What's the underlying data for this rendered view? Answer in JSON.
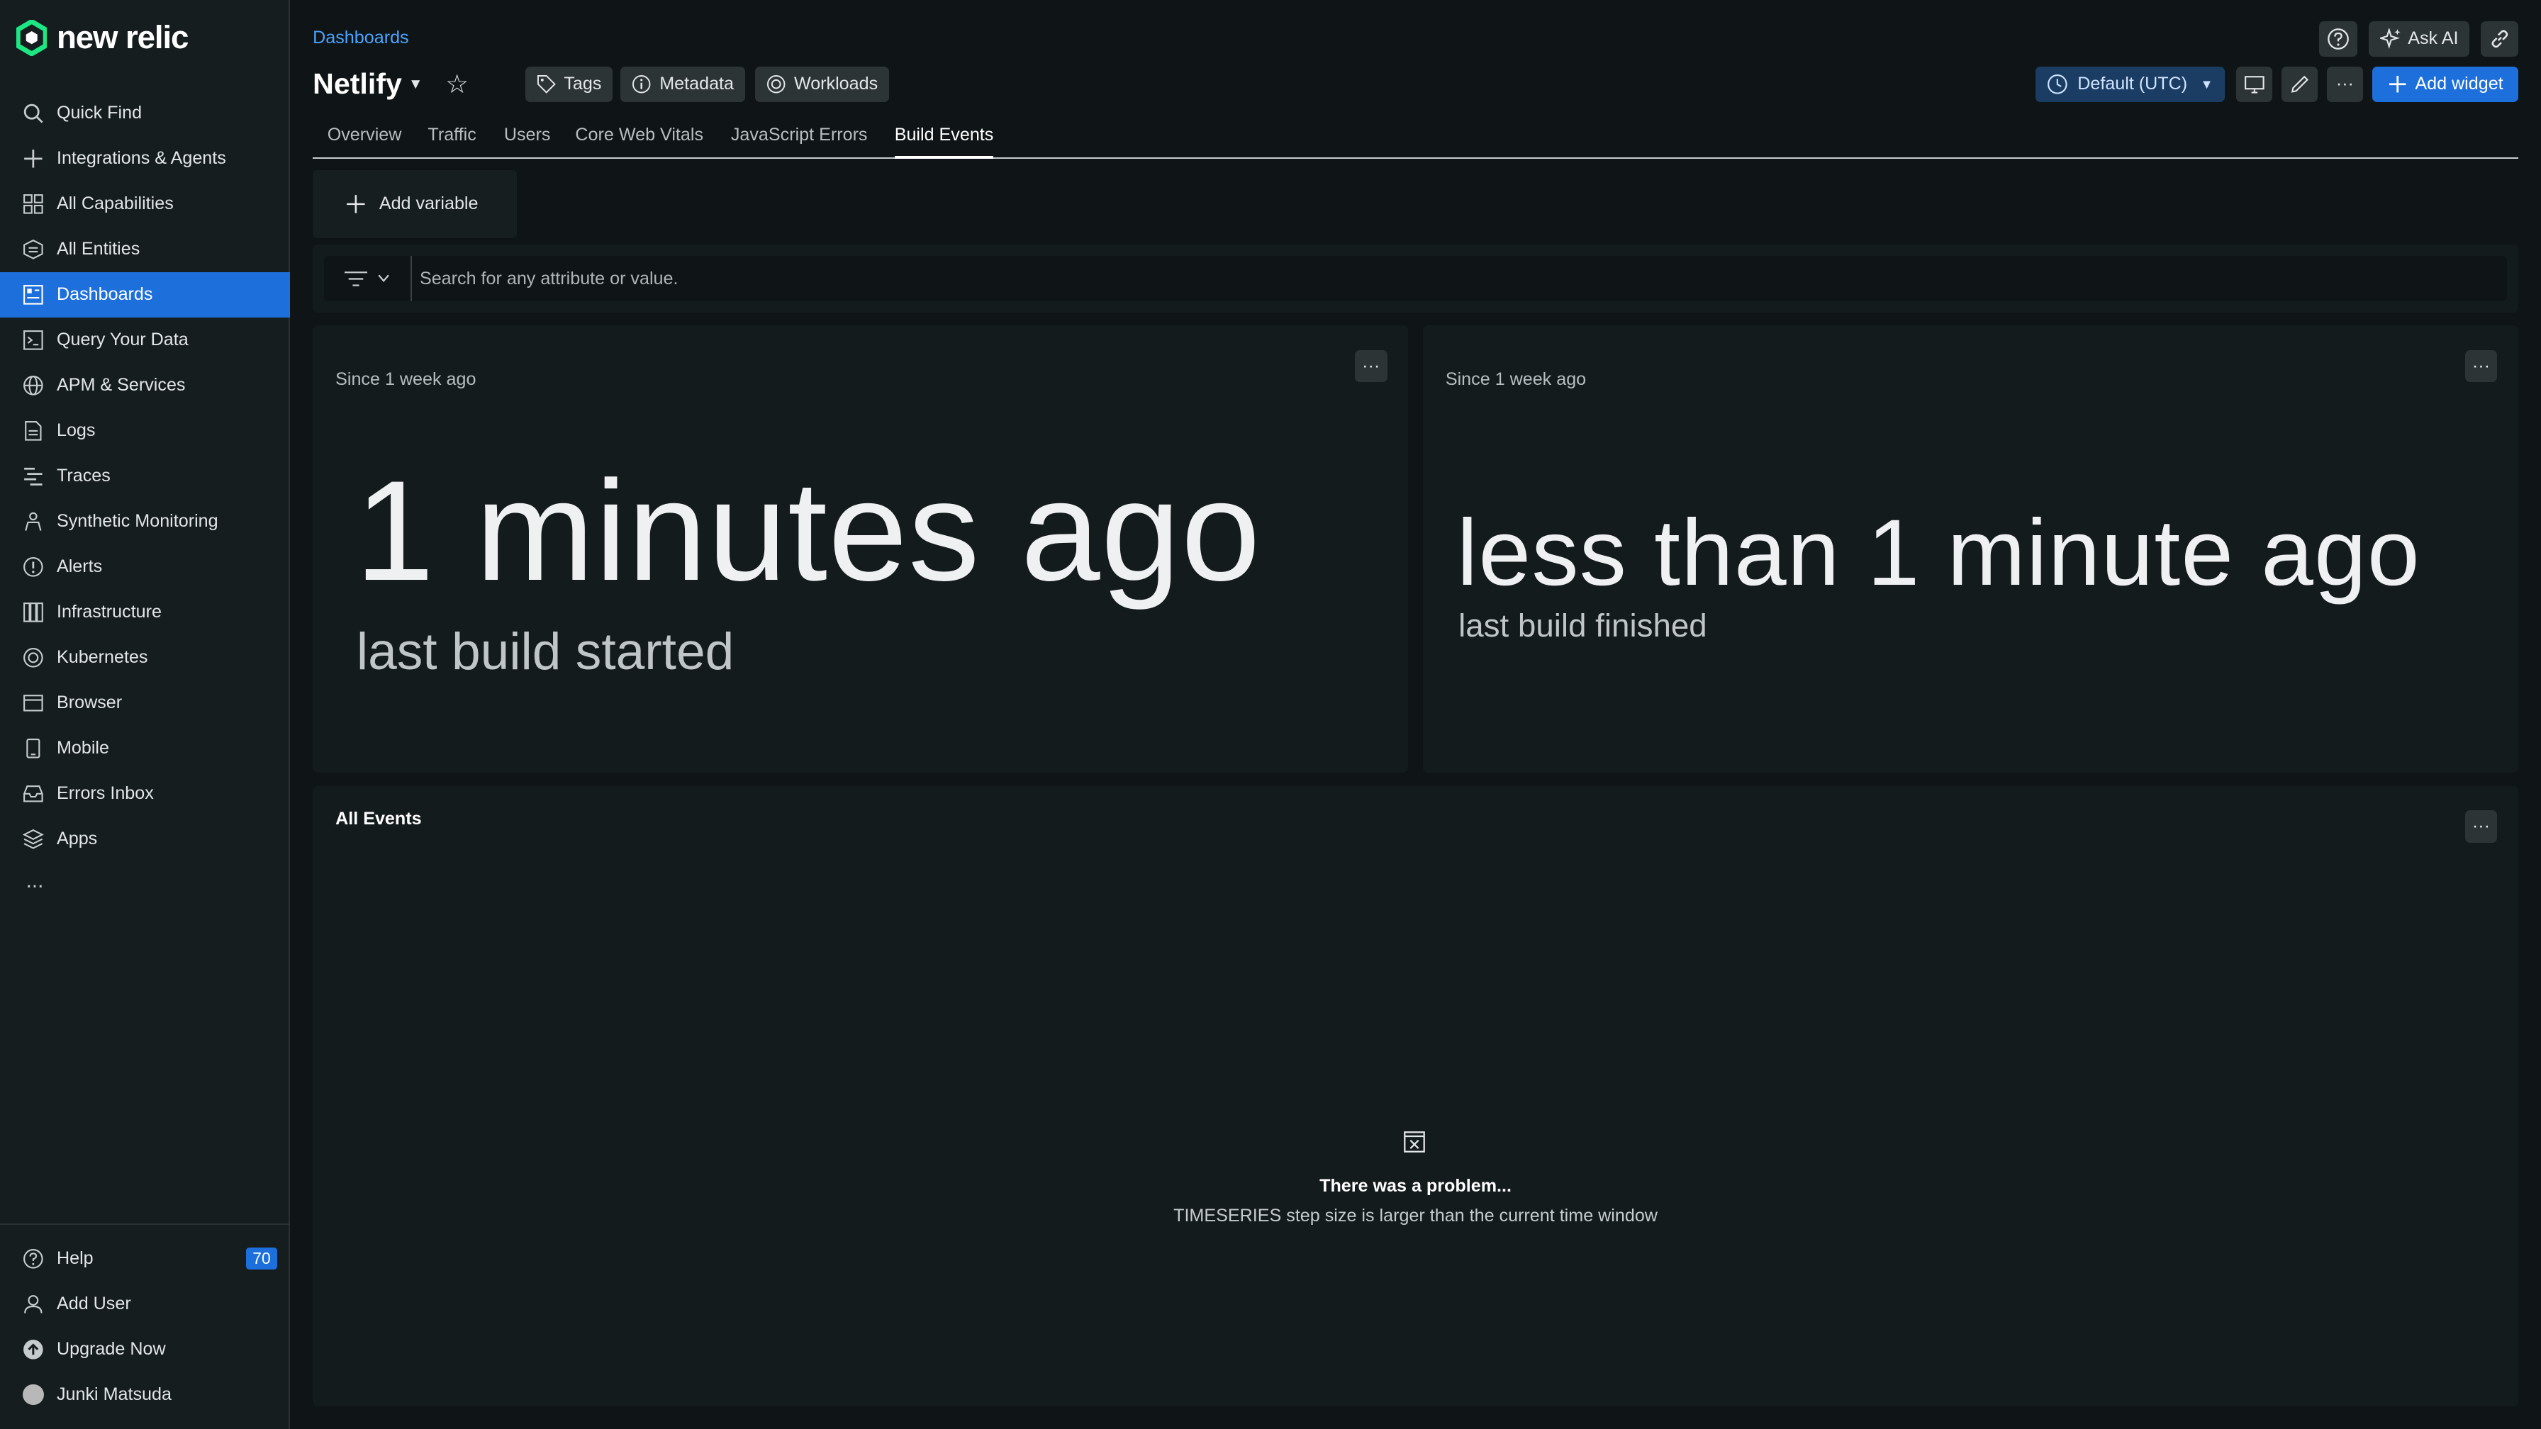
{
  "brand": {
    "name": "new relic"
  },
  "sidebar": {
    "items": [
      {
        "label": "Quick Find",
        "icon": "search-icon"
      },
      {
        "label": "Integrations & Agents",
        "icon": "plus-icon"
      },
      {
        "label": "All Capabilities",
        "icon": "grid-icon"
      },
      {
        "label": "All Entities",
        "icon": "entities-icon"
      },
      {
        "label": "Dashboards",
        "icon": "dashboard-icon",
        "active": true
      },
      {
        "label": "Query Your Data",
        "icon": "terminal-icon"
      },
      {
        "label": "APM & Services",
        "icon": "globe-icon"
      },
      {
        "label": "Logs",
        "icon": "document-icon"
      },
      {
        "label": "Traces",
        "icon": "traces-icon"
      },
      {
        "label": "Synthetic Monitoring",
        "icon": "synthetic-icon"
      },
      {
        "label": "Alerts",
        "icon": "alert-icon"
      },
      {
        "label": "Infrastructure",
        "icon": "infrastructure-icon"
      },
      {
        "label": "Kubernetes",
        "icon": "kubernetes-icon"
      },
      {
        "label": "Browser",
        "icon": "browser-icon"
      },
      {
        "label": "Mobile",
        "icon": "mobile-icon"
      },
      {
        "label": "Errors Inbox",
        "icon": "inbox-icon"
      },
      {
        "label": "Apps",
        "icon": "layers-icon"
      }
    ],
    "more": "...",
    "bottom": [
      {
        "label": "Help",
        "badge": "70"
      },
      {
        "label": "Add User"
      },
      {
        "label": "Upgrade Now"
      },
      {
        "label": "Junki Matsuda"
      }
    ]
  },
  "header": {
    "breadcrumb": "Dashboards",
    "title": "Netlify",
    "chips": {
      "tags": "Tags",
      "metadata": "Metadata",
      "workloads": "Workloads"
    },
    "ask_ai": "Ask AI",
    "timezone": "Default (UTC)",
    "add_widget": "Add widget"
  },
  "tabs": [
    "Overview",
    "Traffic",
    "Users",
    "Core Web Vitals",
    "JavaScript Errors",
    "Build Events"
  ],
  "active_tab": "Build Events",
  "variables": {
    "add_label": "Add variable"
  },
  "filter": {
    "placeholder": "Search for any attribute or value."
  },
  "panels": {
    "started": {
      "since": "Since 1 week ago",
      "value": "1 minutes ago",
      "label": "last build started"
    },
    "finished": {
      "since": "Since 1 week ago",
      "value": "less than 1 minute ago",
      "label": "last build finished"
    },
    "all_events": {
      "title": "All Events",
      "error_title": "There was a problem...",
      "error_message": "TIMESERIES step size is larger than the current time window"
    }
  },
  "colors": {
    "accent": "#1d6fdc",
    "background": "#0f1516",
    "panel": "#141b1d",
    "link": "#4ba3ff"
  }
}
